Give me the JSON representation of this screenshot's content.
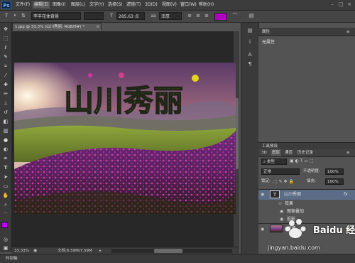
{
  "app": {
    "logo": "Ps"
  },
  "menu": [
    "文件(F)",
    "编辑(E)",
    "图像(I)",
    "图层(L)",
    "文字(Y)",
    "选择(S)",
    "滤镜(T)",
    "3D(D)",
    "视图(V)",
    "窗口(W)",
    "帮助(H)"
  ],
  "menu_active_index": 1,
  "window_controls": [
    "–",
    "□",
    "×"
  ],
  "options": {
    "font_family": "李丰花体背景",
    "font_style": "",
    "font_size": "285.63 点",
    "antialias": "浑厚",
    "color_swatch": "#b000c0"
  },
  "document": {
    "tab_title": "1.jpg @ 33.3% (山川秀丽, RGB/8#) *",
    "close": "×",
    "headline_text": "山川秀丽"
  },
  "status": {
    "zoom": "33.33%",
    "doc_size": "文档:6.59M/7.59M",
    "arrow": "▸"
  },
  "bottom_tab": "时间轴",
  "properties": {
    "title": "属性",
    "content": "无属性"
  },
  "layers_panel": {
    "title": "工具预设",
    "tabs": [
      "3D",
      "图层",
      "通道",
      "历史记录"
    ],
    "kind_filter": "类型",
    "blend_mode": "正常",
    "opacity_label": "不透明度:",
    "opacity_value": "100%",
    "lock_label": "锁定:",
    "fill_label": "填充:",
    "fill_value": "100%",
    "layers": [
      {
        "name": "山川秀丽",
        "type": "text",
        "thumb": "T",
        "fx": "fx"
      },
      {
        "name": "效果",
        "type": "effects-group"
      },
      {
        "name": "图案叠加",
        "type": "effect"
      },
      {
        "name": "投影",
        "type": "effect"
      },
      {
        "name": "背景",
        "type": "image",
        "lock": "🔒"
      }
    ]
  },
  "watermark": {
    "brand": "Baidu 经验",
    "url": "jingyan.baidu.com"
  },
  "colors": {
    "accent_magenta": "#b000c0",
    "foreground": "#c000ff",
    "background": "#ffffff"
  }
}
